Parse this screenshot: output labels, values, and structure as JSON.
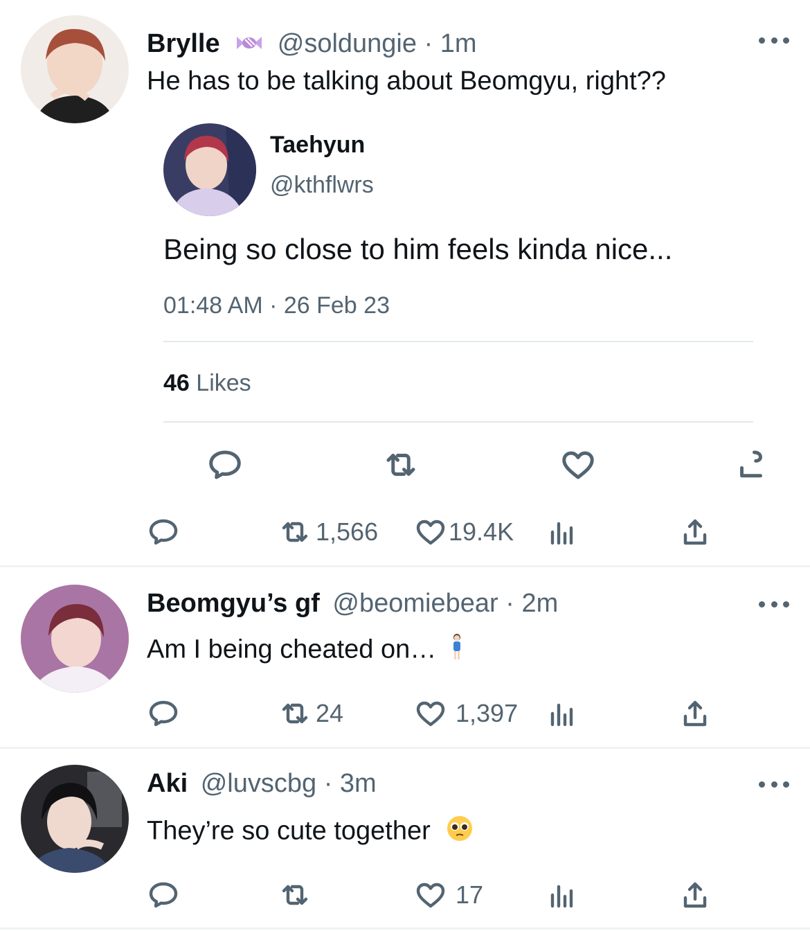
{
  "tweets": [
    {
      "name": "Brylle",
      "name_emoji": "candy",
      "handle": "@soldungie",
      "separator": "·",
      "time": "1m",
      "text": "He has to be talking about Beomgyu, right??",
      "quote": {
        "name": "Taehyun",
        "handle": "@kthflwrs",
        "text": "Being so close to him feels kinda nice...",
        "timestamp": "01:48 AM · 26 Feb 23",
        "likes_count": "46",
        "likes_label": "Likes"
      },
      "retweets": "1,566",
      "likes": "19.4K"
    },
    {
      "name": "Beomgyu’s gf",
      "handle": "@beomiebear",
      "separator": "·",
      "time": "2m",
      "text": "Am I being cheated on…",
      "text_emoji": "person-standing",
      "retweets": "24",
      "likes": "1,397"
    },
    {
      "name": "Aki",
      "handle": "@luvscbg",
      "separator": "·",
      "time": "3m",
      "text": "They’re so cute together",
      "text_emoji": "pleading-face",
      "retweets": "",
      "likes": "17"
    }
  ],
  "icons": {
    "reply": "reply-icon",
    "retweet": "retweet-icon",
    "like": "heart-icon",
    "views": "views-icon",
    "share": "share-icon",
    "more": "more-icon"
  },
  "colors": {
    "text_primary": "#0f1419",
    "text_secondary": "#536471",
    "divider": "#eff3f4"
  }
}
